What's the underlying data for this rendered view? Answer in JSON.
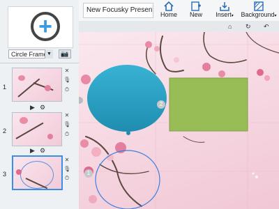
{
  "frame_selector": {
    "value": "Circle Frame"
  },
  "toolbar": {
    "title_value": "New Focusky Presenta",
    "home_label": "Home",
    "new_label": "New",
    "insert_label": "Insert",
    "background_label": "Background"
  },
  "slides": [
    {
      "number": "1"
    },
    {
      "number": "2"
    },
    {
      "number": "3"
    }
  ],
  "canvas_markers": [
    "1",
    "2"
  ],
  "colors": {
    "accent": "#3a8ee6",
    "circle": "#2aa6c8",
    "rect": "#98bd56",
    "canvas_bg": "#f5d4df"
  },
  "icons": {
    "home": "home-icon",
    "new": "new-slide-icon",
    "insert": "insert-icon",
    "background": "background-icon"
  }
}
